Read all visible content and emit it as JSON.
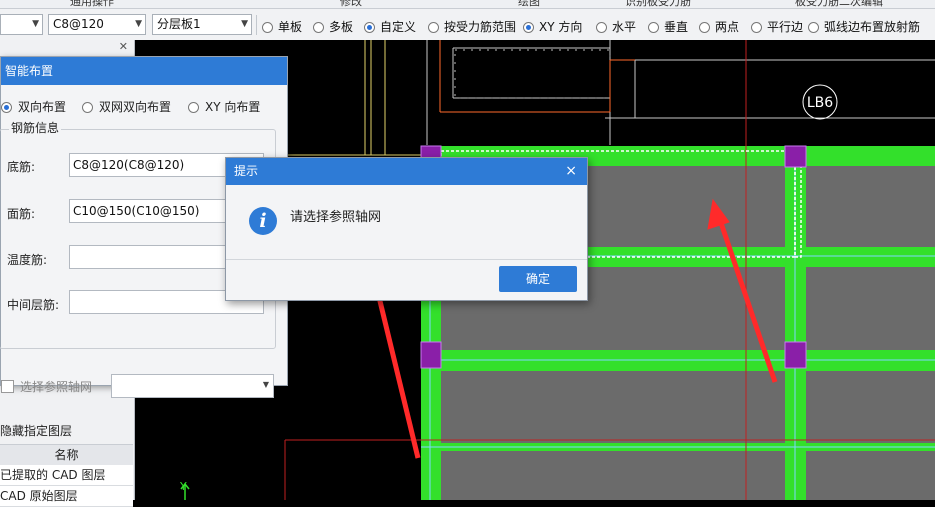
{
  "top_strip": [
    "通用操作",
    "修改",
    "绘图",
    "识别板受力筋",
    "板受力筋二次编辑"
  ],
  "toolbar": {
    "combo1": "",
    "combo2": "C8@120",
    "combo3": "分层板1",
    "radios": [
      {
        "label": "单板",
        "checked": false
      },
      {
        "label": "多板",
        "checked": false
      },
      {
        "label": "自定义",
        "checked": true
      },
      {
        "label": "按受力筋范围",
        "checked": false
      },
      {
        "label": "XY 方向",
        "checked": true
      },
      {
        "label": "水平",
        "checked": false
      },
      {
        "label": "垂直",
        "checked": false
      },
      {
        "label": "两点",
        "checked": false
      },
      {
        "label": "平行边",
        "checked": false
      },
      {
        "label": "弧线边布置放射筋",
        "checked": false
      }
    ]
  },
  "layer_panel": {
    "title": "隐藏指定图层",
    "column": "名称",
    "rows": [
      "已提取的 CAD 图层",
      "CAD 原始图层"
    ]
  },
  "smart_dialog": {
    "title": "智能布置",
    "options": [
      {
        "label": "双向布置",
        "checked": true
      },
      {
        "label": "双网双向布置",
        "checked": false
      },
      {
        "label": "XY 向布置",
        "checked": false
      }
    ],
    "group": "钢筋信息",
    "fields": [
      {
        "label": "底筋:",
        "value": "C8@120(C8@120)"
      },
      {
        "label": "面筋:",
        "value": "C10@150(C10@150)"
      },
      {
        "label": "温度筋:",
        "value": ""
      },
      {
        "label": "中间层筋:",
        "value": ""
      }
    ],
    "checkbox": "选择参照轴网"
  },
  "message_box": {
    "title": "提示",
    "text": "请选择参照轴网",
    "ok": "确定",
    "close": "×"
  },
  "cad": {
    "slab_label": "LB6",
    "axis_label": "Y"
  },
  "colors": {
    "accent": "#2e7bd6",
    "beam_green": "#33e02b",
    "slab_gray": "#6b6b6b",
    "column_purple": "#8a1fa8",
    "arrow_red": "#ff2a2a"
  }
}
